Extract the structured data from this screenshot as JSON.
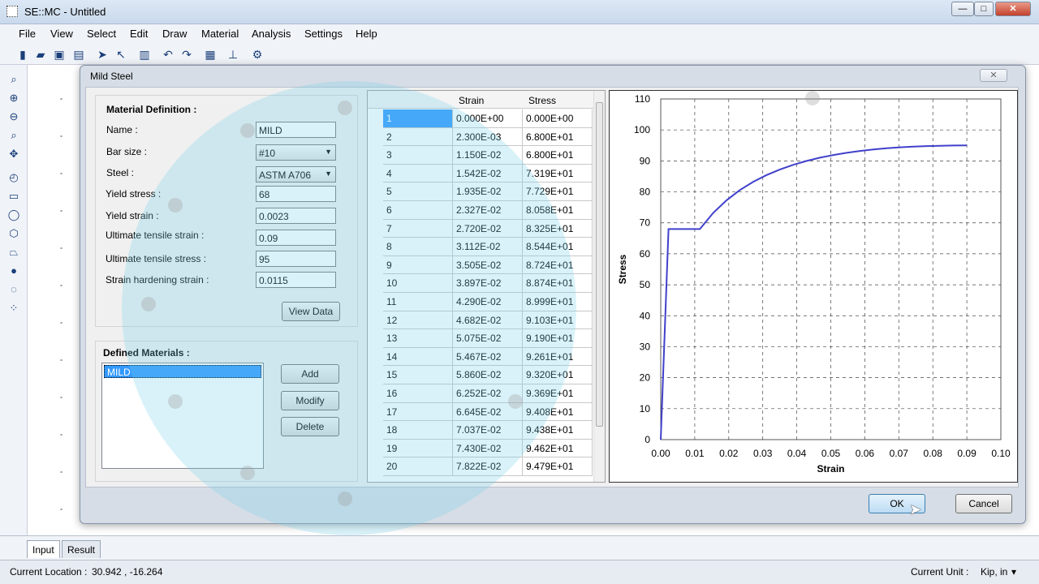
{
  "window": {
    "title": "SE::MC - Untitled",
    "min": "—",
    "max": "□",
    "close": "✕"
  },
  "menu": [
    "File",
    "View",
    "Select",
    "Edit",
    "Draw",
    "Material",
    "Analysis",
    "Settings",
    "Help"
  ],
  "toolbar_icons": [
    "new-file-icon",
    "open-folder-icon",
    "save-icon",
    "print-icon",
    "select-arrow-icon",
    "select-node-icon",
    "delete-icon",
    "undo-icon",
    "redo-icon",
    "report-icon",
    "hierarchy-icon",
    "settings-icon"
  ],
  "left_tools": [
    "zoom-icon",
    "zoom-in-icon",
    "zoom-out-icon",
    "zoom-window-icon",
    "pan-icon",
    "rotate-icon",
    "rectangle-icon",
    "circle-icon",
    "polygon-icon",
    "shape-icon",
    "point-icon",
    "circle-bars-icon",
    "rect-bars-icon"
  ],
  "dialog": {
    "title": "Mild Steel",
    "close": "✕",
    "material_definition": {
      "heading": "Material Definition :",
      "name_label": "Name :",
      "name_value": "MILD",
      "bar_size_label": "Bar size :",
      "bar_size_value": "#10",
      "steel_label": "Steel :",
      "steel_value": "ASTM A706",
      "yield_stress_label": "Yield stress :",
      "yield_stress_value": "68",
      "yield_strain_label": "Yield strain :",
      "yield_strain_value": "0.0023",
      "uts_strain_label": "Ultimate tensile strain :",
      "uts_strain_value": "0.09",
      "uts_stress_label": "Ultimate tensile stress :",
      "uts_stress_value": "95",
      "hardening_label": "Strain hardening strain :",
      "hardening_value": "0.0115",
      "view_data": "View Data"
    },
    "defined_materials": {
      "heading": "Defined Materials :",
      "items": [
        "MILD"
      ],
      "add": "Add",
      "modify": "Modify",
      "delete": "Delete"
    },
    "table": {
      "headers": [
        "Strain",
        "Stress"
      ],
      "rows": [
        [
          "1",
          "0.000E+00",
          "0.000E+00"
        ],
        [
          "2",
          "2.300E-03",
          "6.800E+01"
        ],
        [
          "3",
          "1.150E-02",
          "6.800E+01"
        ],
        [
          "4",
          "1.542E-02",
          "7.319E+01"
        ],
        [
          "5",
          "1.935E-02",
          "7.729E+01"
        ],
        [
          "6",
          "2.327E-02",
          "8.058E+01"
        ],
        [
          "7",
          "2.720E-02",
          "8.325E+01"
        ],
        [
          "8",
          "3.112E-02",
          "8.544E+01"
        ],
        [
          "9",
          "3.505E-02",
          "8.724E+01"
        ],
        [
          "10",
          "3.897E-02",
          "8.874E+01"
        ],
        [
          "11",
          "4.290E-02",
          "8.999E+01"
        ],
        [
          "12",
          "4.682E-02",
          "9.103E+01"
        ],
        [
          "13",
          "5.075E-02",
          "9.190E+01"
        ],
        [
          "14",
          "5.467E-02",
          "9.261E+01"
        ],
        [
          "15",
          "5.860E-02",
          "9.320E+01"
        ],
        [
          "16",
          "6.252E-02",
          "9.369E+01"
        ],
        [
          "17",
          "6.645E-02",
          "9.408E+01"
        ],
        [
          "18",
          "7.037E-02",
          "9.438E+01"
        ],
        [
          "19",
          "7.430E-02",
          "9.462E+01"
        ],
        [
          "20",
          "7.822E-02",
          "9.479E+01"
        ]
      ]
    },
    "ok": "OK",
    "cancel": "Cancel"
  },
  "chart_data": {
    "type": "line",
    "xlabel": "Strain",
    "ylabel": "Stress",
    "xlim": [
      0,
      0.1
    ],
    "ylim": [
      0,
      110
    ],
    "xticks": [
      "0.00",
      "0.01",
      "0.02",
      "0.03",
      "0.04",
      "0.05",
      "0.06",
      "0.07",
      "0.08",
      "0.09",
      "0.10"
    ],
    "yticks": [
      "0",
      "10",
      "20",
      "30",
      "40",
      "50",
      "60",
      "70",
      "80",
      "90",
      "100",
      "110"
    ],
    "grid": true,
    "series": [
      {
        "color": "#4040cc",
        "x": [
          0,
          0.0023,
          0.0115,
          0.01542,
          0.01935,
          0.02327,
          0.0272,
          0.03112,
          0.03505,
          0.03897,
          0.0429,
          0.04682,
          0.05075,
          0.05467,
          0.0586,
          0.06252,
          0.06645,
          0.07037,
          0.0743,
          0.07822,
          0.082,
          0.086,
          0.09
        ],
        "y": [
          0,
          68,
          68,
          73.19,
          77.29,
          80.58,
          83.25,
          85.44,
          87.24,
          88.74,
          89.99,
          91.03,
          91.9,
          92.61,
          93.2,
          93.69,
          94.08,
          94.38,
          94.62,
          94.79,
          94.9,
          94.97,
          95
        ]
      }
    ]
  },
  "tabs": [
    "Input",
    "Result"
  ],
  "status": {
    "location_label": "Current Location :",
    "location_value": "30.942 , -16.264",
    "unit_label": "Current Unit :",
    "unit_value": "Kip, in",
    "unit_arrow": "▾"
  }
}
